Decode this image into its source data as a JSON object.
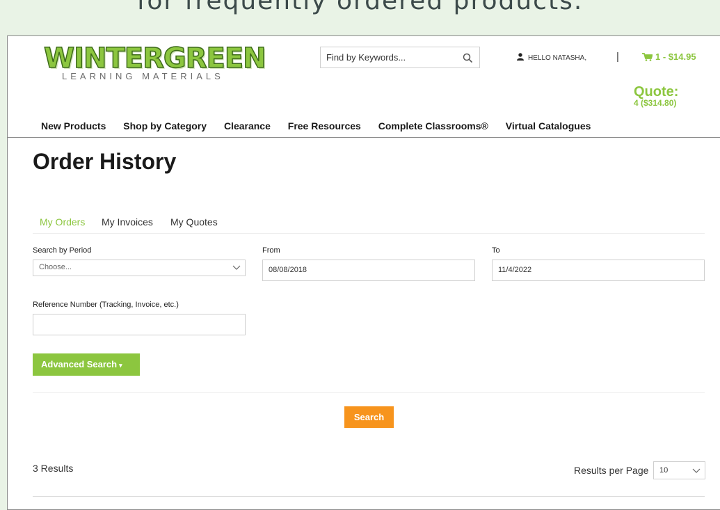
{
  "banner": {
    "text": "for frequently ordered products."
  },
  "brand": {
    "name": "WINTERGREEN",
    "tagline": "LEARNING MATERIALS",
    "colors": {
      "green": "#8cc63f",
      "orange": "#f7941d"
    }
  },
  "header": {
    "search_placeholder": "Find by Keywords...",
    "user_greeting": "HELLO NATASHA,",
    "separator": "|",
    "cart": "1 - $14.95",
    "quote_label": "Quote:",
    "quote_value": "4 ($314.80)"
  },
  "nav": {
    "items": [
      {
        "label": "New Products"
      },
      {
        "label": "Shop by Category"
      },
      {
        "label": "Clearance"
      },
      {
        "label": "Free Resources"
      },
      {
        "label": "Complete Classrooms®"
      },
      {
        "label": "Virtual Catalogues"
      }
    ]
  },
  "page": {
    "title": "Order History"
  },
  "tabs": [
    {
      "label": "My Orders",
      "active": true
    },
    {
      "label": "My Invoices",
      "active": false
    },
    {
      "label": "My Quotes",
      "active": false
    }
  ],
  "form": {
    "period_label": "Search by Period",
    "period_value": "Choose...",
    "from_label": "From",
    "from_value": "08/08/2018",
    "to_label": "To",
    "to_value": "11/4/2022",
    "reference_label": "Reference Number (Tracking, Invoice, etc.)",
    "reference_value": "",
    "advanced_search": "Advanced Search",
    "advanced_caret": "▾",
    "search_button": "Search"
  },
  "results": {
    "count_text": "3 Results",
    "per_page_label": "Results per Page",
    "per_page_value": "10"
  }
}
